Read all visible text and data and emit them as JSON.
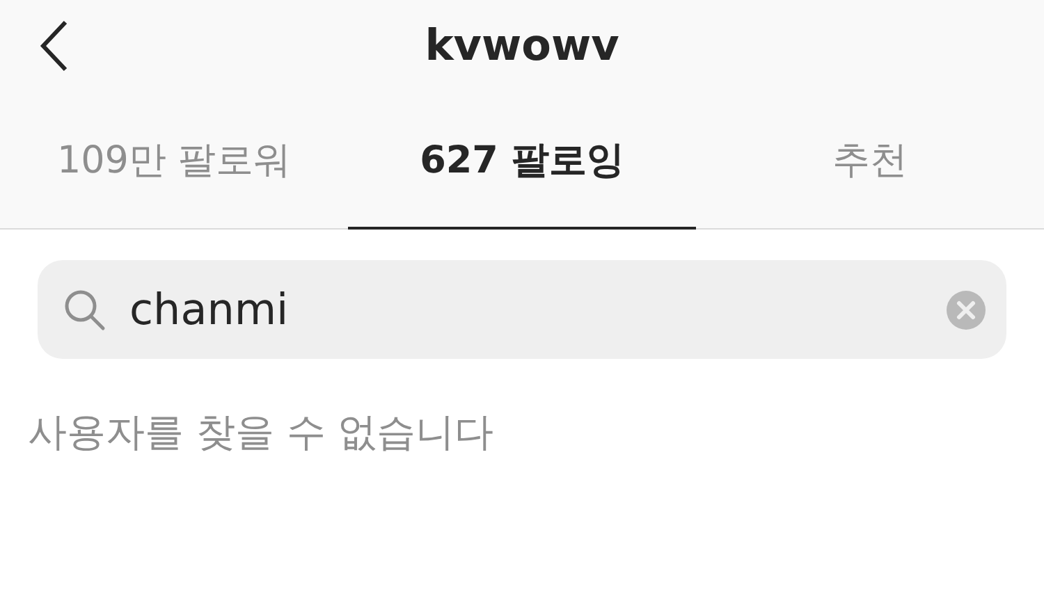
{
  "header": {
    "title": "kvwowv"
  },
  "tabs": [
    {
      "label": "109만 팔로워",
      "selected": false
    },
    {
      "label": "627 팔로잉",
      "selected": true
    },
    {
      "label": "추천",
      "selected": false
    }
  ],
  "search": {
    "value": "chanmi"
  },
  "message": "사용자를 찾을 수 없습니다"
}
